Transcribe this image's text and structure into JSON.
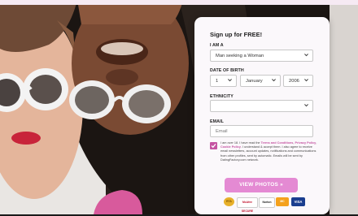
{
  "header": {
    "top_link_1": "",
    "top_link_2": ""
  },
  "form": {
    "title": "Sign up for FREE!",
    "i_am_label": "I AM A",
    "i_am_value": "Man seeking a Woman",
    "dob_label": "DATE OF BIRTH",
    "dob_day": "1",
    "dob_month": "January",
    "dob_year": "2006",
    "ethnicity_label": "ETHNICITY",
    "ethnicity_value": "",
    "email_label": "EMAIL",
    "email_placeholder": "Email",
    "terms_text": "I am over 18. I have read the",
    "terms_link": "Terms and Conditions",
    "terms_privacy": "Privacy Policy",
    "terms_cookie": "Cookie Policy",
    "terms_rest": ". I understand & accept them. I also agree to receive email newsletters, account updates, notifications and communications from other profiles, sent by automatic. Emails will be sent by DatingFactory.com network.",
    "checkbox_checked": true,
    "submit_label": "VIEW PHOTOS »"
  },
  "badges": [
    {
      "name": "rta-badge",
      "label": "RTA"
    },
    {
      "name": "mcafee-badge",
      "label": "McAfee SECURE"
    },
    {
      "name": "norton-badge",
      "label": "Norton"
    },
    {
      "name": "mastercard-badge",
      "label": "MC"
    },
    {
      "name": "visa-badge",
      "label": "VISA"
    }
  ],
  "colors": {
    "accent": "#c554a2",
    "button": "#e48ad3",
    "panel_bg": "#fbf8fb"
  }
}
